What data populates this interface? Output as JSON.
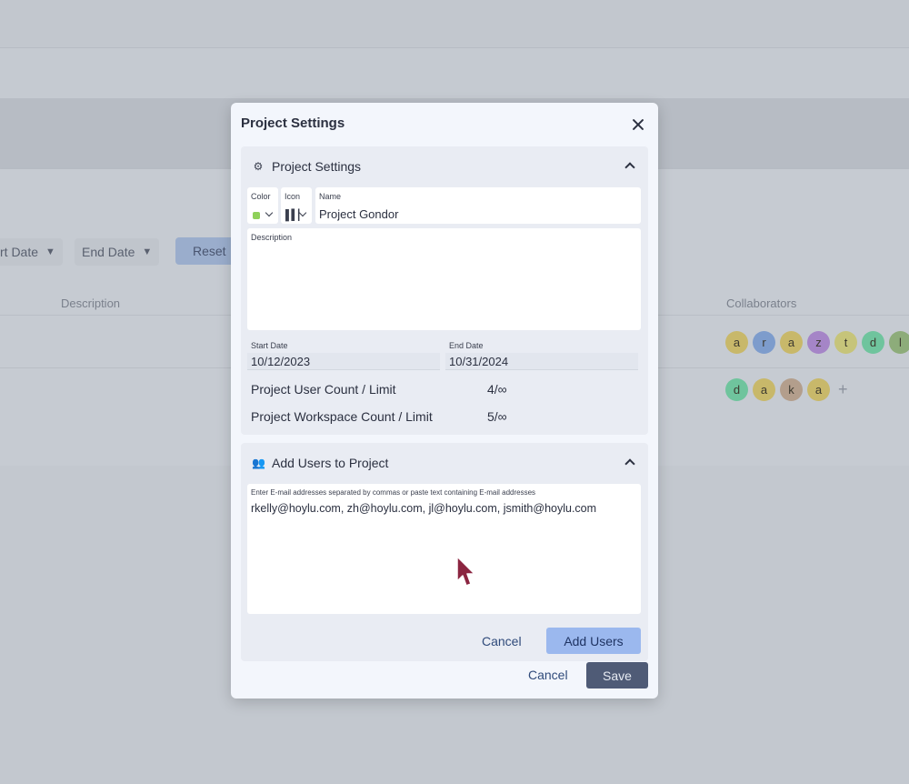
{
  "background": {
    "filters": [
      {
        "label": "rt Date"
      },
      {
        "label": "End Date"
      }
    ],
    "reset_label": "Reset",
    "columns": {
      "description": "Description",
      "collaborators": "Collaborators"
    },
    "rows": [
      {
        "avatars": [
          {
            "letter": "a",
            "color": "#c8b86a"
          },
          {
            "letter": "r",
            "color": "#7d9ccc"
          },
          {
            "letter": "a",
            "color": "#c8b86a"
          },
          {
            "letter": "z",
            "color": "#a585c7"
          },
          {
            "letter": "t",
            "color": "#c6c47a"
          },
          {
            "letter": "d",
            "color": "#6fc49d"
          },
          {
            "letter": "l",
            "color": "#8dac7a"
          }
        ]
      },
      {
        "avatars": [
          {
            "letter": "d",
            "color": "#6fc49d"
          },
          {
            "letter": "a",
            "color": "#c8b86a"
          },
          {
            "letter": "k",
            "color": "#b39e8c"
          },
          {
            "letter": "a",
            "color": "#c8b86a"
          }
        ],
        "add_label": "+"
      }
    ]
  },
  "modal": {
    "title": "Project Settings",
    "settings_section": {
      "title": "Project Settings",
      "icon": "gears-icon",
      "color_label": "Color",
      "color_value": "#8fd15a",
      "icon_label": "Icon",
      "icon_value": "chart-icon",
      "name_label": "Name",
      "name_value": "Project Gondor",
      "description_label": "Description",
      "description_value": "",
      "start_date_label": "Start Date",
      "start_date_value": "10/12/2023",
      "end_date_label": "End Date",
      "end_date_value": "10/31/2024",
      "user_count_label": "Project User Count / Limit",
      "user_count_value": "4/∞",
      "workspace_count_label": "Project Workspace Count / Limit",
      "workspace_count_value": "5/∞"
    },
    "add_users_section": {
      "title": "Add Users to Project",
      "icon": "users-icon",
      "emails_label": "Enter E-mail addresses separated by commas or paste text containing E-mail addresses",
      "emails_value": "rkelly@hoylu.com, zh@hoylu.com, jl@hoylu.com, jsmith@hoylu.com",
      "cancel_label": "Cancel",
      "add_label": "Add Users"
    },
    "cancel_label": "Cancel",
    "save_label": "Save"
  }
}
